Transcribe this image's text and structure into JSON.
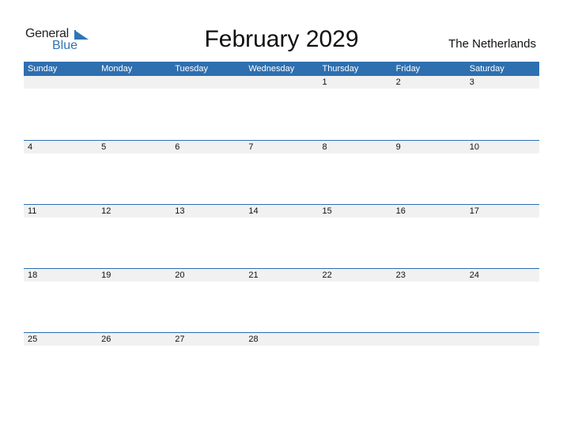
{
  "logo": {
    "part1": "General",
    "part2": "Blue"
  },
  "title": "February 2029",
  "country": "The Netherlands",
  "colors": {
    "accent": "#2e6fb0",
    "row_bg": "#f1f1f1"
  },
  "weekdays": [
    "Sunday",
    "Monday",
    "Tuesday",
    "Wednesday",
    "Thursday",
    "Friday",
    "Saturday"
  ],
  "weeks": [
    [
      "",
      "",
      "",
      "",
      "1",
      "2",
      "3"
    ],
    [
      "4",
      "5",
      "6",
      "7",
      "8",
      "9",
      "10"
    ],
    [
      "11",
      "12",
      "13",
      "14",
      "15",
      "16",
      "17"
    ],
    [
      "18",
      "19",
      "20",
      "21",
      "22",
      "23",
      "24"
    ],
    [
      "25",
      "26",
      "27",
      "28",
      "",
      "",
      ""
    ]
  ]
}
